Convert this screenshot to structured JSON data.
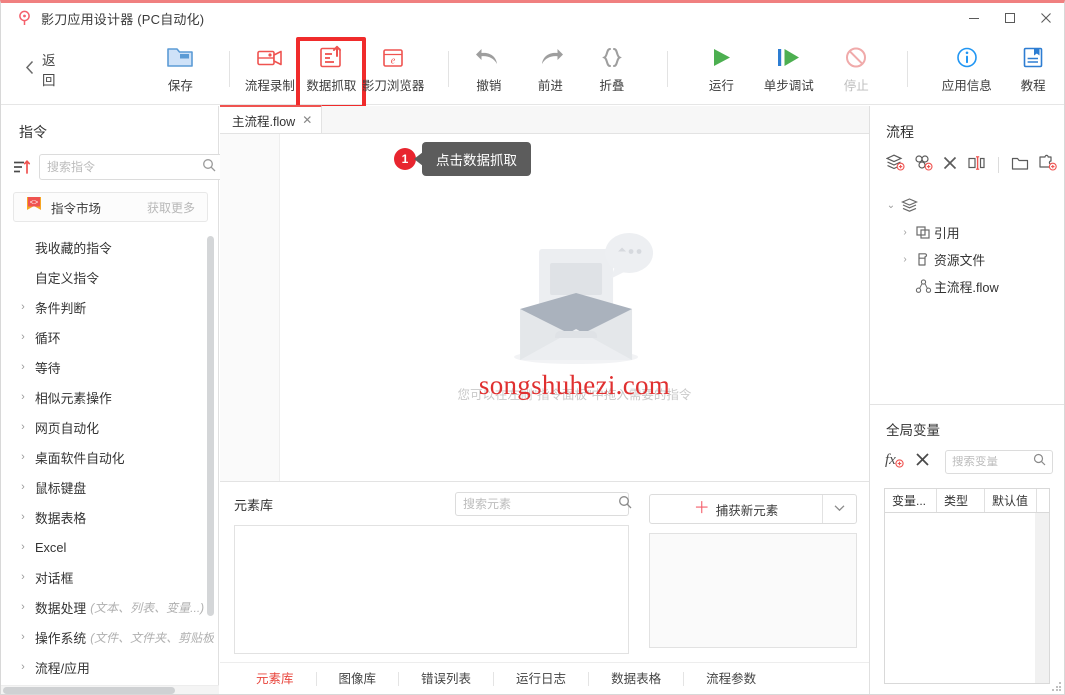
{
  "window": {
    "title": "影刀应用设计器 (PC自动化)",
    "logo_icon": "yingdao-logo-icon",
    "controls": {
      "minimize": "−",
      "maximize": "□",
      "close": "✕"
    }
  },
  "toolbar": {
    "back_label": "返回",
    "items": [
      {
        "label": "保存",
        "icon": "folder-save-icon",
        "disabled": false
      },
      {
        "label": "流程录制",
        "icon": "record-camera-icon",
        "disabled": false
      },
      {
        "label": "数据抓取",
        "icon": "data-capture-icon",
        "disabled": false,
        "highlighted": true
      },
      {
        "label": "影刀浏览器",
        "icon": "browser-icon",
        "disabled": false
      },
      {
        "label": "撤销",
        "icon": "undo-arrow-icon",
        "disabled": false
      },
      {
        "label": "前进",
        "icon": "redo-arrow-icon",
        "disabled": false
      },
      {
        "label": "折叠",
        "icon": "braces-icon",
        "disabled": false
      },
      {
        "label": "运行",
        "icon": "play-triangle-icon",
        "disabled": false
      },
      {
        "label": "单步调试",
        "icon": "step-debug-icon",
        "disabled": false
      },
      {
        "label": "停止",
        "icon": "stop-forbidden-icon",
        "disabled": true
      },
      {
        "label": "应用信息",
        "icon": "info-circle-icon",
        "disabled": false
      },
      {
        "label": "教程",
        "icon": "tutorial-book-icon",
        "disabled": false
      }
    ],
    "highlight_color": "#f02b2b"
  },
  "left_panel": {
    "title": "指令",
    "sort_icon": "sort-ascending-icon",
    "search": {
      "placeholder": "搜索指令",
      "value": "",
      "icon": "search-icon"
    },
    "market": {
      "label": "指令市场",
      "more": "获取更多",
      "icon": "code-bracket-icon"
    },
    "commands": [
      {
        "label": "我收藏的指令",
        "expandable": false
      },
      {
        "label": "自定义指令",
        "expandable": false
      },
      {
        "label": "条件判断",
        "expandable": true
      },
      {
        "label": "循环",
        "expandable": true
      },
      {
        "label": "等待",
        "expandable": true
      },
      {
        "label": "相似元素操作",
        "expandable": true
      },
      {
        "label": "网页自动化",
        "expandable": true
      },
      {
        "label": "桌面软件自动化",
        "expandable": true
      },
      {
        "label": "鼠标键盘",
        "expandable": true
      },
      {
        "label": "数据表格",
        "expandable": true
      },
      {
        "label": "Excel",
        "expandable": true
      },
      {
        "label": "对话框",
        "expandable": true
      },
      {
        "label": "数据处理",
        "hint": "(文本、列表、变量...)",
        "expandable": true
      },
      {
        "label": "操作系统",
        "hint": "(文件、文件夹、剪贴板",
        "expandable": true
      },
      {
        "label": "流程/应用",
        "expandable": true
      }
    ]
  },
  "center": {
    "tab": {
      "label": "主流程.flow",
      "close_icon": "close-icon"
    },
    "callout": {
      "badge": "1",
      "text": "点击数据抓取"
    },
    "empty": {
      "hint": "您可以在左侧\"指令面板\"中拖入需要的指令",
      "illustration": "empty-inbox-icon"
    },
    "watermark": "songshuhezi.com"
  },
  "bottom_panel": {
    "element_library": {
      "title": "元素库",
      "search": {
        "placeholder": "搜索元素",
        "value": "",
        "icon": "search-icon"
      }
    },
    "capture": {
      "label": "捕获新元素",
      "plus_icon": "plus-icon",
      "caret_icon": "chevron-down-icon"
    },
    "tabs": [
      {
        "label": "元素库",
        "active": true
      },
      {
        "label": "图像库",
        "active": false
      },
      {
        "label": "错误列表",
        "active": false
      },
      {
        "label": "运行日志",
        "active": false
      },
      {
        "label": "数据表格",
        "active": false
      },
      {
        "label": "流程参数",
        "active": false
      }
    ],
    "active_color": "#e8453c"
  },
  "right_panel": {
    "flow": {
      "title": "流程",
      "tools": [
        {
          "icon": "add-layers-icon"
        },
        {
          "icon": "add-group-icon"
        },
        {
          "icon": "delete-x-icon"
        },
        {
          "icon": "rename-icon"
        },
        {
          "icon": "folder-icon"
        },
        {
          "icon": "add-module-icon"
        }
      ],
      "tree": [
        {
          "label": "",
          "icon": "layers-icon",
          "depth": 1,
          "expanded": true
        },
        {
          "label": "引用",
          "icon": "reference-icon",
          "depth": 2,
          "expandable": true
        },
        {
          "label": "资源文件",
          "icon": "resource-file-icon",
          "depth": 2,
          "expandable": true
        },
        {
          "label": "主流程.flow",
          "icon": "flow-node-icon",
          "depth": 3,
          "expandable": false
        }
      ]
    },
    "global_variables": {
      "title": "全局变量",
      "add_icon": "add-function-icon",
      "delete_icon": "delete-x-icon",
      "search": {
        "placeholder": "搜索变量",
        "value": "",
        "icon": "search-icon"
      },
      "columns": [
        "变量...",
        "类型",
        "默认值",
        ""
      ],
      "rows": []
    }
  }
}
